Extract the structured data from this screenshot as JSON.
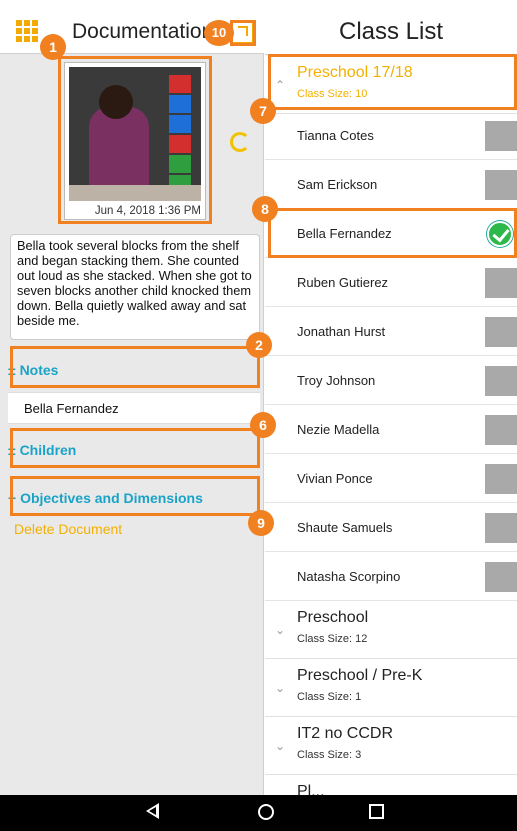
{
  "left": {
    "title": "Documentation",
    "photo_date": "Jun  4, 2018 1:36 PM",
    "description": "Bella took several blocks from the shelf and began stacking them. She counted out loud as she stacked. When she got to seven blocks another child knocked them down. Bella quietly walked away and sat beside me.",
    "notes_label": "± Notes",
    "child_name": "Bella Fernandez",
    "children_label": "± Children",
    "objectives_label": "+ Objectives and Dimensions",
    "delete_label": "Delete Document"
  },
  "right": {
    "title": "Class List",
    "active_group": {
      "name": "Preschool 17/18",
      "size": "Class Size: 10"
    },
    "students": [
      {
        "name": "Tianna Cotes",
        "checked": false
      },
      {
        "name": "Sam Erickson",
        "checked": false
      },
      {
        "name": "Bella Fernandez",
        "checked": true
      },
      {
        "name": "Ruben Gutierez",
        "checked": false
      },
      {
        "name": "Jonathan Hurst",
        "checked": false
      },
      {
        "name": "Troy Johnson",
        "checked": false
      },
      {
        "name": "Nezie Madella",
        "checked": false
      },
      {
        "name": "Vivian Ponce",
        "checked": false
      },
      {
        "name": "Shaute Samuels",
        "checked": false
      },
      {
        "name": "Natasha Scorpino",
        "checked": false
      }
    ],
    "groups": [
      {
        "name": "Preschool",
        "size": "Class Size: 12"
      },
      {
        "name": "Preschool / Pre-K",
        "size": "Class Size: 1"
      },
      {
        "name": "IT2 no CCDR",
        "size": "Class Size: 3"
      },
      {
        "name": "Pl...",
        "size": ""
      }
    ]
  },
  "annotations": [
    "1",
    "2",
    "6",
    "7",
    "8",
    "9",
    "10"
  ],
  "icons": {
    "apps": "grid-icon",
    "share": "share-icon",
    "refresh": "refresh-icon",
    "chevron_up": "chevron-up-icon",
    "chevron_down": "chevron-down-icon",
    "check": "check-circle-icon",
    "back": "nav-back-icon",
    "home": "nav-home-icon",
    "recents": "nav-recents-icon"
  },
  "colors": {
    "accent_orange": "#f08020",
    "accent_yellow": "#f2b100",
    "link_blue": "#1aa3c8",
    "check_green": "#2db84b"
  }
}
